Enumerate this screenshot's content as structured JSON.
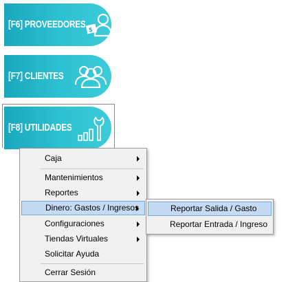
{
  "tiles": [
    {
      "label": "[F6] PROVEEDORES",
      "icon": "supplier-icon"
    },
    {
      "label": "[F7] CLIENTES",
      "icon": "clients-icon"
    },
    {
      "label": "[F8] UTILIDADES",
      "icon": "utilities-icon"
    }
  ],
  "colors": {
    "tile_gradient_start": "#1aa7bd",
    "tile_gradient_end": "#3ccbd9",
    "menu_bg": "#f0f0f0",
    "highlight_bg": "#c5daf3",
    "highlight_border": "#7ba5d9"
  },
  "menu": {
    "items": [
      {
        "label": "Caja",
        "has_submenu": true
      },
      {
        "label": "Mantenimientos",
        "has_submenu": true
      },
      {
        "label": "Reportes",
        "has_submenu": true
      },
      {
        "label": "Dinero: Gastos / Ingresos",
        "has_submenu": true,
        "highlighted": true
      },
      {
        "label": "Configuraciones",
        "has_submenu": true
      },
      {
        "label": "Tiendas Virtuales",
        "has_submenu": true
      },
      {
        "label": "Solicitar Ayuda",
        "has_submenu": false
      },
      {
        "label": "Cerrar Sesión",
        "has_submenu": false
      }
    ]
  },
  "submenu": {
    "items": [
      {
        "label": "Reportar Salida / Gasto",
        "highlighted": true
      },
      {
        "label": "Reportar Entrada / Ingreso",
        "highlighted": false
      }
    ]
  }
}
